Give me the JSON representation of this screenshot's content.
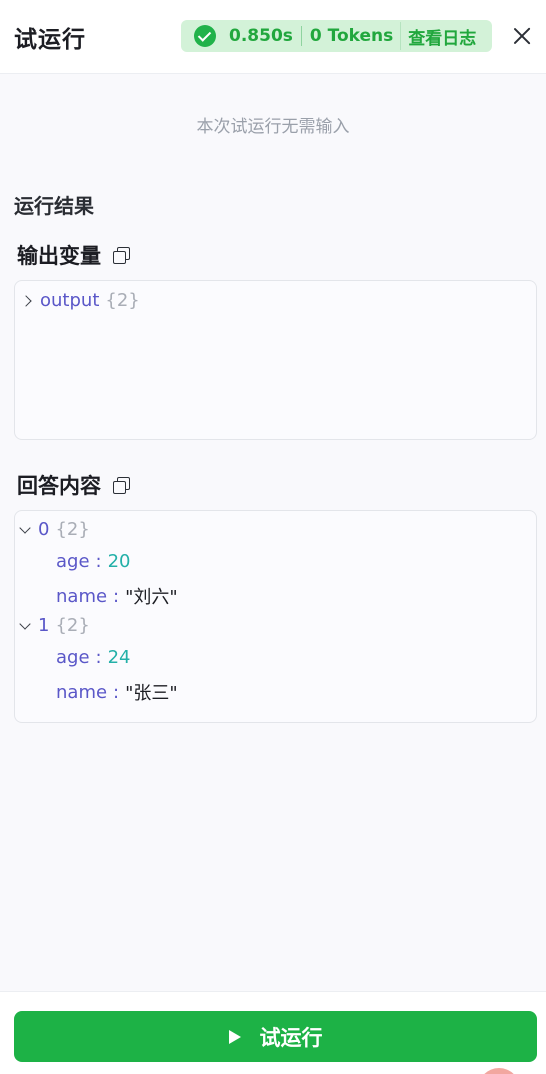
{
  "header": {
    "title": "试运行",
    "status": {
      "duration": "0.850s",
      "tokens": "0 Tokens",
      "view_log": "查看日志"
    }
  },
  "input": {
    "hint": "本次试运行无需输入"
  },
  "result": {
    "title": "运行结果",
    "output_variables": {
      "label": "输出变量",
      "key": "output",
      "count": "{2}"
    },
    "answer": {
      "label": "回答内容",
      "items": [
        {
          "index": "0",
          "count": "{2}",
          "fields": [
            {
              "key": "age",
              "value": "20"
            },
            {
              "key": "name",
              "value": "\"刘六\""
            }
          ]
        },
        {
          "index": "1",
          "count": "{2}",
          "fields": [
            {
              "key": "age",
              "value": "24"
            },
            {
              "key": "name",
              "value": "\"张三\""
            }
          ]
        }
      ]
    }
  },
  "footer": {
    "run_label": "试运行"
  },
  "colors": {
    "accent": "#1db246",
    "status_bg": "#d3f2d8",
    "status_text": "#21a73d",
    "json_key": "#5a57c8",
    "json_number": "#23b0a8"
  },
  "icons": [
    "check-circle-icon",
    "close-icon",
    "copy-icon",
    "chevron-right-icon",
    "chevron-down-icon",
    "play-icon"
  ]
}
